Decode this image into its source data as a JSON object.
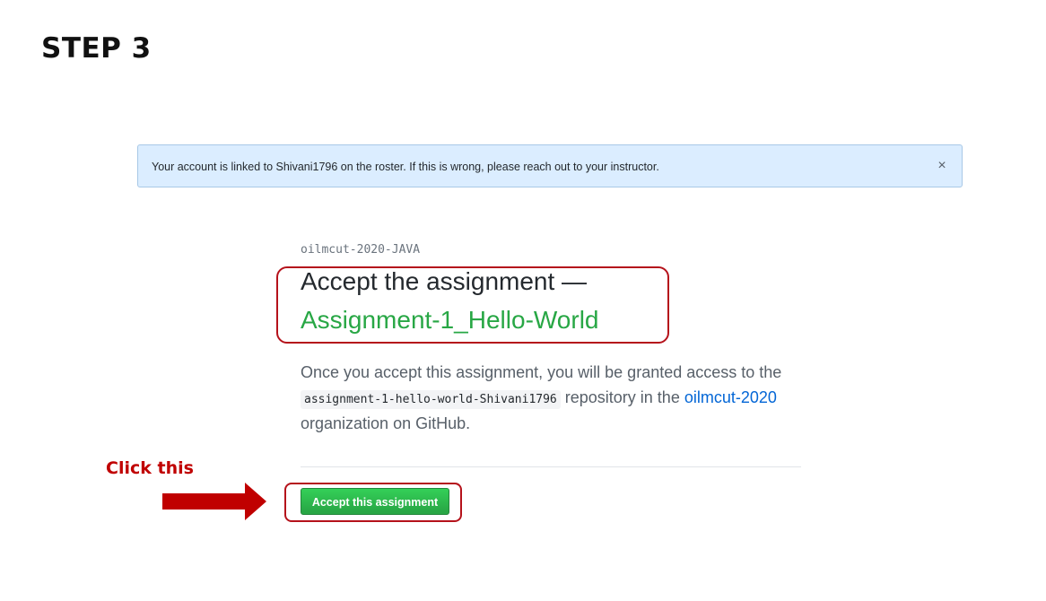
{
  "step": {
    "title": "STEP 3"
  },
  "flash": {
    "message": "Your account is linked to Shivani1796 on the roster. If this is wrong, please reach out to your instructor.",
    "close_glyph": "×"
  },
  "assignment": {
    "org_classroom": "oilmcut-2020-JAVA",
    "heading_prefix": "Accept the assignment —",
    "name": "Assignment-1_Hello-World",
    "desc_part1": "Once you accept this assignment, you will be granted access to the ",
    "repo_name": "assignment-1-hello-world-Shivani1796",
    "desc_part2": " repository in the ",
    "org_link": "oilmcut-2020",
    "desc_part3": " organization on GitHub.",
    "accept_button_label": "Accept this assignment"
  },
  "annotation": {
    "click_label": "Click this",
    "color": "#c00000"
  },
  "colors": {
    "accent_green": "#28a745",
    "link_blue": "#0366d6",
    "flash_bg": "#dbedff",
    "highlight_red": "#b5121b"
  }
}
